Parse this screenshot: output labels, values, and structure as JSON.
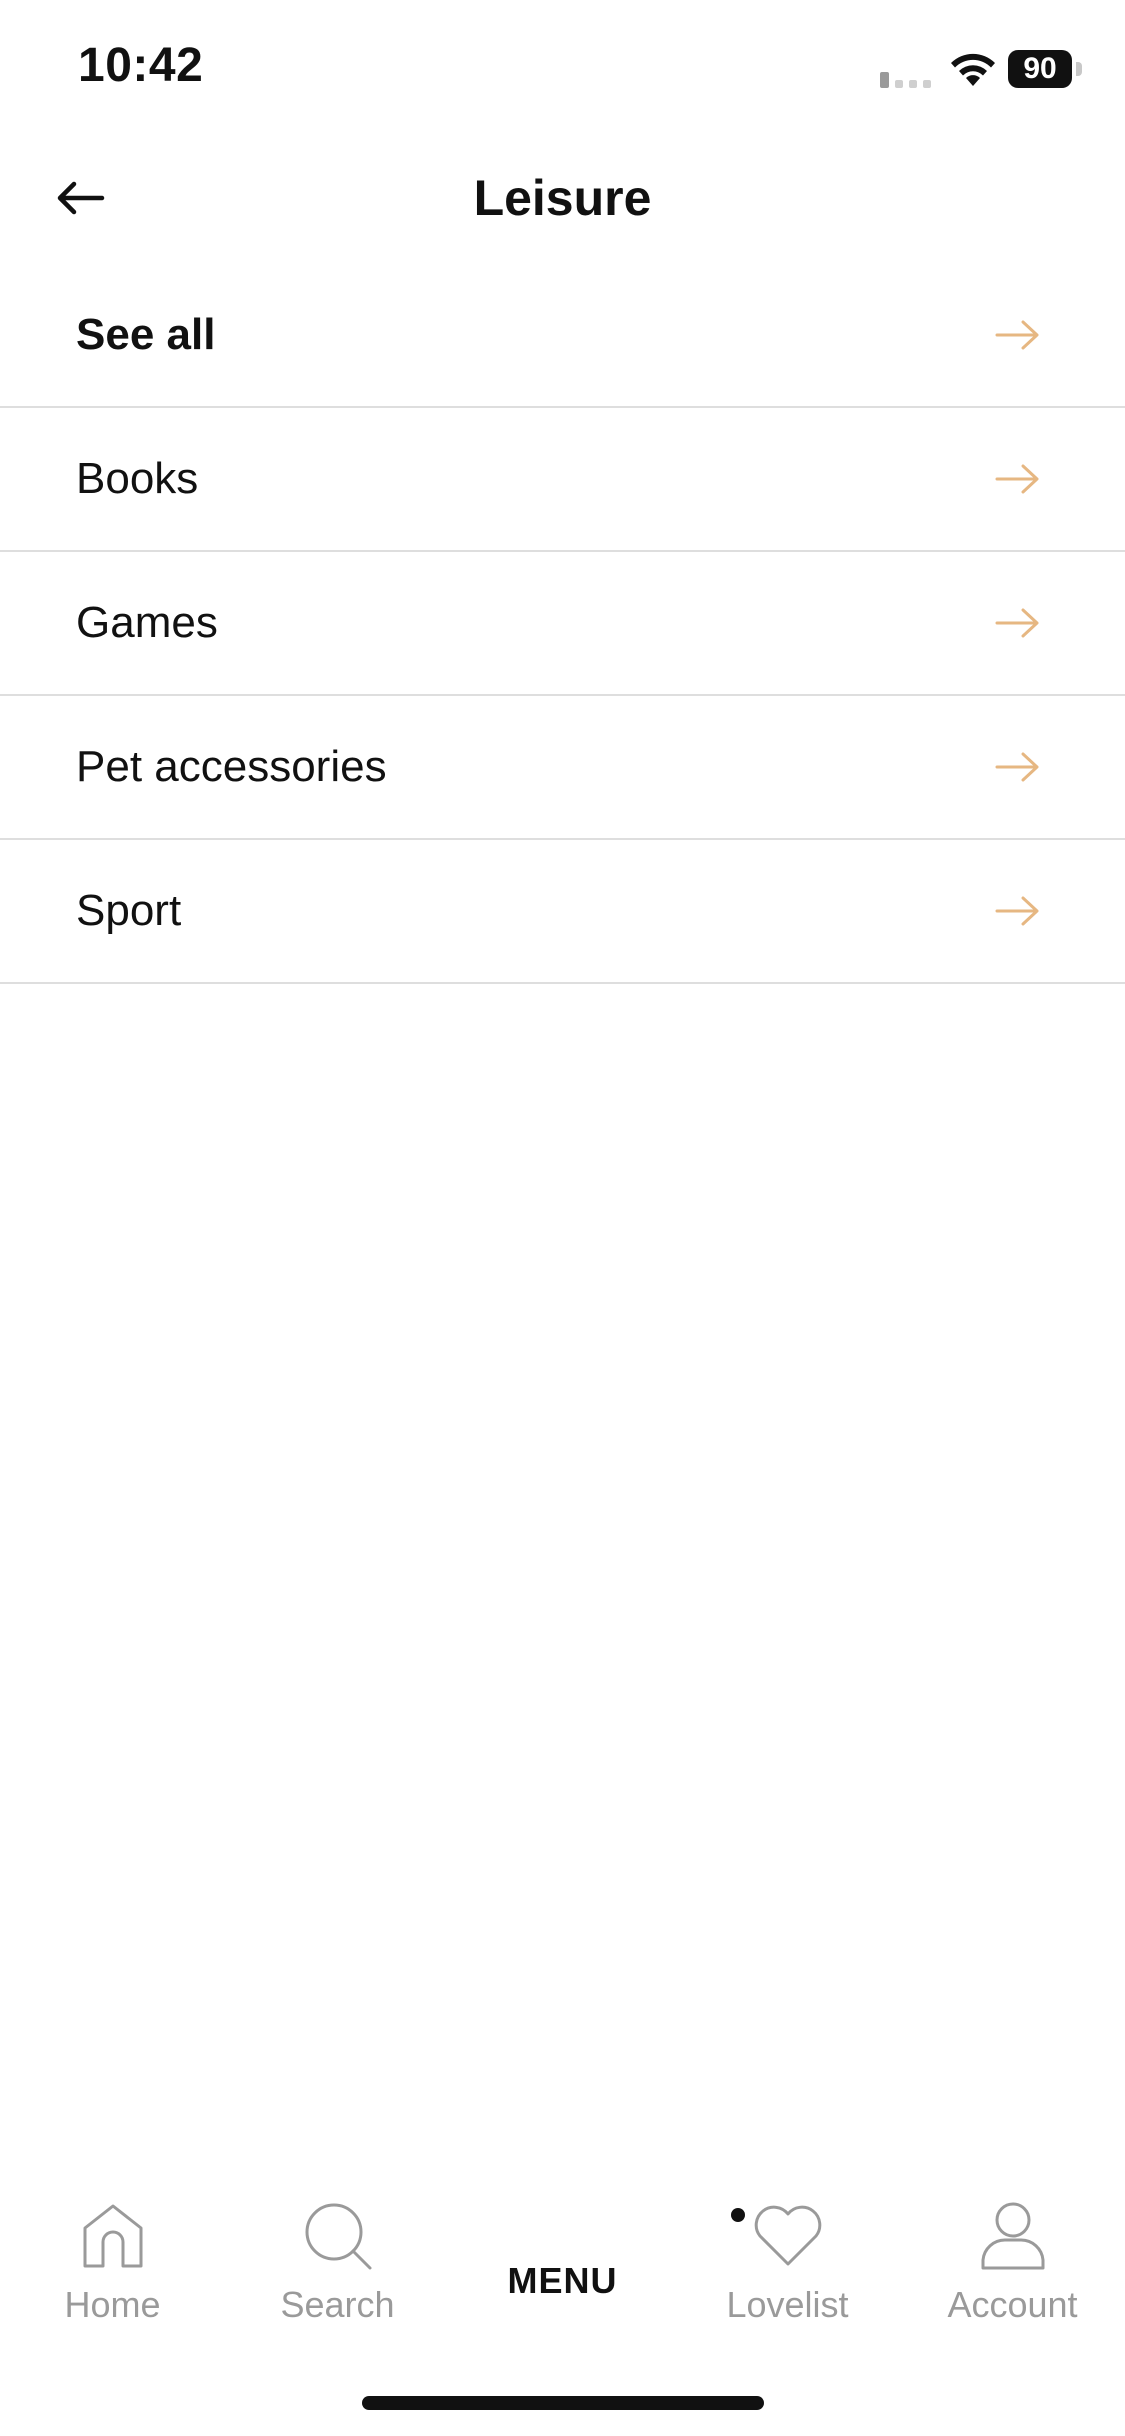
{
  "status_bar": {
    "time": "10:42",
    "battery": "90"
  },
  "header": {
    "title": "Leisure",
    "back_icon": "arrow-left-icon"
  },
  "categories": [
    {
      "label": "See all"
    },
    {
      "label": "Books"
    },
    {
      "label": "Games"
    },
    {
      "label": "Pet accessories"
    },
    {
      "label": "Sport"
    }
  ],
  "tab_bar": {
    "home": {
      "label": "Home",
      "icon": "house-icon"
    },
    "search": {
      "label": "Search",
      "icon": "magnifier-icon"
    },
    "menu": {
      "label": "MENU"
    },
    "lovelist": {
      "label": "Lovelist",
      "icon": "heart-icon"
    },
    "account": {
      "label": "Account",
      "icon": "person-icon"
    }
  },
  "colors": {
    "arrow_accent": "#E6B782",
    "divider": "#DEDEDE",
    "inactive_tab": "#9A9A9A"
  }
}
